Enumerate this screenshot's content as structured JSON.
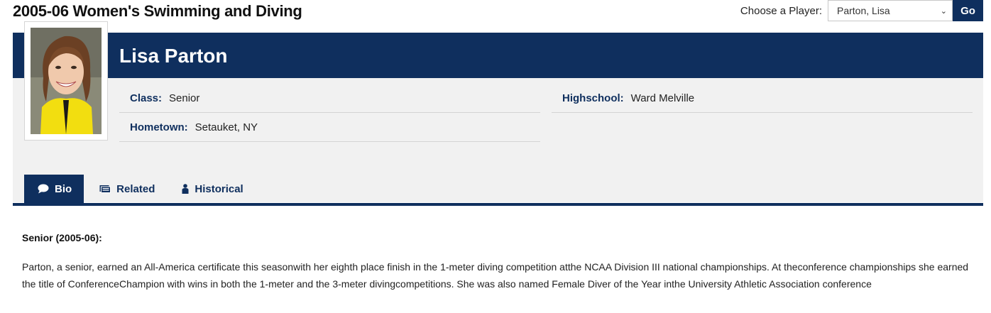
{
  "header": {
    "title": "2005-06 Women's Swimming and Diving",
    "chooser_label": "Choose a Player:",
    "selected_player": "Parton, Lisa",
    "go_label": "Go"
  },
  "player": {
    "name": "Lisa Parton",
    "fields": {
      "class_label": "Class:",
      "class_value": "Senior",
      "hometown_label": "Hometown:",
      "hometown_value": "Setauket, NY",
      "highschool_label": "Highschool:",
      "highschool_value": "Ward Melville"
    }
  },
  "tabs": [
    {
      "label": "Bio",
      "icon": "speech-bubble-icon",
      "active": true
    },
    {
      "label": "Related",
      "icon": "related-news-icon",
      "active": false
    },
    {
      "label": "Historical",
      "icon": "person-icon",
      "active": false
    }
  ],
  "bio": {
    "heading": "Senior (2005-06):",
    "body": "Parton, a senior, earned an All-America certificate this seasonwith her eighth place finish in the 1-meter diving competition atthe NCAA Division III national championships.  At theconference championships she earned the title of ConferenceChampion with wins in both the 1-meter and the 3-meter divingcompetitions.  She was also named Female Diver of the Year inthe University Athletic Association conference"
  },
  "colors": {
    "brand_navy": "#0f2f5e",
    "panel_gray": "#f1f1f1"
  }
}
